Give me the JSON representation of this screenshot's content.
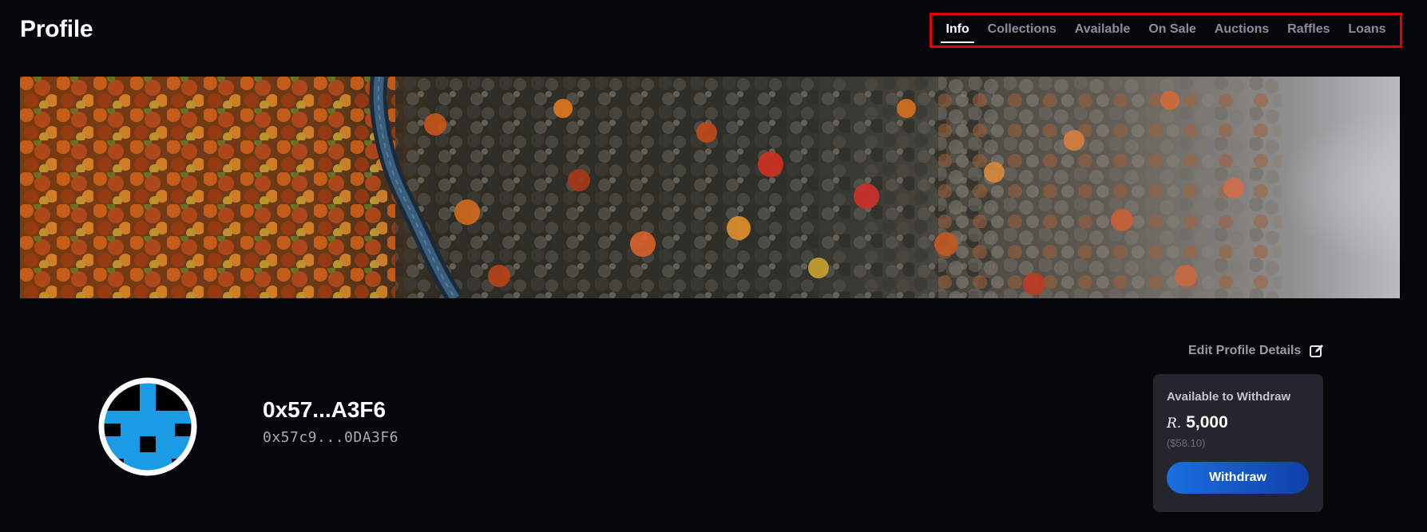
{
  "header": {
    "title": "Profile"
  },
  "tabs": [
    {
      "label": "Info",
      "active": true
    },
    {
      "label": "Collections",
      "active": false
    },
    {
      "label": "Available",
      "active": false
    },
    {
      "label": "On Sale",
      "active": false
    },
    {
      "label": "Auctions",
      "active": false
    },
    {
      "label": "Raffles",
      "active": false
    },
    {
      "label": "Loans",
      "active": false
    }
  ],
  "banner": {
    "icon": "autumn-forest-aerial-image"
  },
  "profile": {
    "edit_label": "Edit Profile Details",
    "edit_icon": "edit-icon",
    "display_name": "0x57...A3F6",
    "address": "0x57c9...0DA3F6",
    "avatar_icon": "pixel-identicon"
  },
  "withdraw": {
    "title": "Available to Withdraw",
    "currency_symbol": "R.",
    "amount": "5,000",
    "usd_value": "($58.10)",
    "button_label": "Withdraw"
  },
  "colors": {
    "background": "#06070b",
    "tab_highlight_border": "#e3000f",
    "avatar_blue": "#1a9be6",
    "card_background": "#24252d",
    "button_gradient_start": "#1a6fe0",
    "button_gradient_end": "#1040a8"
  }
}
